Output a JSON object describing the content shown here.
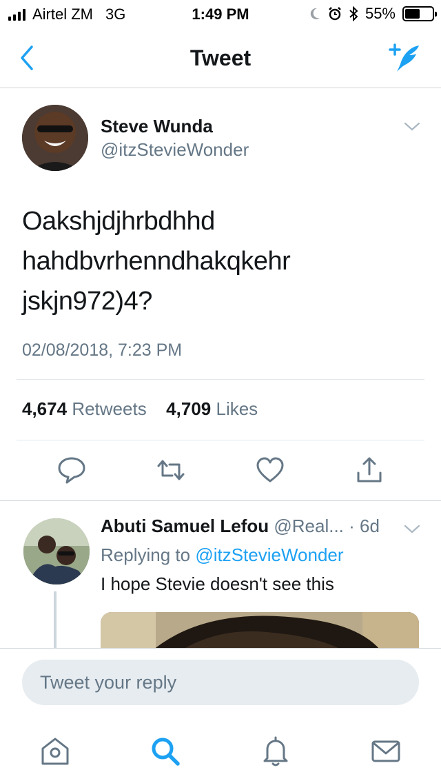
{
  "status_bar": {
    "carrier": "Airtel ZM",
    "network": "3G",
    "time": "1:49 PM",
    "battery": "55%",
    "battery_level": 0.55,
    "icons": [
      "signal-icon",
      "moon-icon",
      "alarm-icon",
      "bluetooth-icon",
      "battery-icon"
    ]
  },
  "nav": {
    "title": "Tweet",
    "back_icon": "chevron-left-icon",
    "compose_icon": "compose-tweet-icon"
  },
  "tweet": {
    "author_name": "Steve Wunda",
    "author_handle": "@itzStevieWonder",
    "text_lines": [
      "Oakshjdjhrbdhhd",
      "hahdbvrhenndhakqkehr",
      "jskjn972)4?"
    ],
    "timestamp": "02/08/2018, 7:23 PM",
    "retweet_count": "4,674",
    "retweet_label": "Retweets",
    "like_count": "4,709",
    "like_label": "Likes",
    "actions": [
      "reply-icon",
      "retweet-icon",
      "like-icon",
      "share-icon"
    ]
  },
  "reply": {
    "author_name": "Abuti Samuel Lefou",
    "author_handle": "@Real...",
    "age": "· 6d",
    "replying_prefix": "Replying to",
    "replying_to": "@itzStevieWonder",
    "text": "I hope Stevie doesn't see this"
  },
  "composer": {
    "placeholder": "Tweet your reply"
  },
  "tab_bar": {
    "tabs": [
      "home-icon",
      "search-icon",
      "notifications-icon",
      "messages-icon"
    ]
  },
  "colors": {
    "accent": "#1da1f2",
    "text_primary": "#14171a",
    "text_secondary": "#657786",
    "divider": "#e1e8ed",
    "input_bg": "#e6ecf0"
  }
}
